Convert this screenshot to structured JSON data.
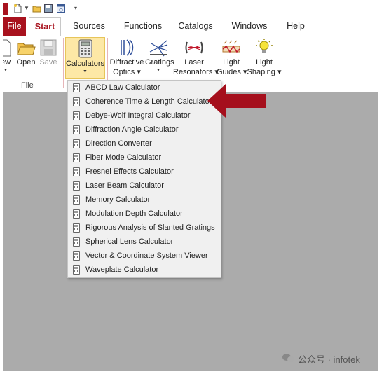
{
  "tabs": [
    {
      "label": "File"
    },
    {
      "label": "Start"
    },
    {
      "label": "Sources"
    },
    {
      "label": "Functions"
    },
    {
      "label": "Catalogs"
    },
    {
      "label": "Windows"
    },
    {
      "label": "Help"
    }
  ],
  "ribbon": {
    "new_partial": "ew",
    "open": "Open",
    "save": "Save",
    "file_group": "File",
    "calculators": "Calculators",
    "diffractive_1": "Diffractive",
    "diffractive_2": "Optics",
    "gratings": "Gratings",
    "laser_1": "Laser",
    "laser_2": "Resonators",
    "light_guides_1": "Light",
    "light_guides_2": "Guides",
    "light_shaping_1": "Light",
    "light_shaping_2": "Shaping"
  },
  "dropdown_items": [
    "ABCD Law Calculator",
    "Coherence Time & Length Calculator",
    "Debye-Wolf Integral Calculator",
    "Diffraction Angle Calculator",
    "Direction Converter",
    "Fiber Mode Calculator",
    "Fresnel Effects Calculator",
    "Laser Beam Calculator",
    "Memory Calculator",
    "Modulation Depth Calculator",
    "Rigorous Analysis of Slanted Gratings",
    "Spherical Lens Calculator",
    "Vector & Coordinate System Viewer",
    "Waveplate Calculator"
  ],
  "watermark": "公众号 · infotek",
  "colors": {
    "brand_red": "#a8121e",
    "arrow_red": "#a50f1c",
    "workspace_gray": "#ababab",
    "highlight": "#fde8a6"
  }
}
